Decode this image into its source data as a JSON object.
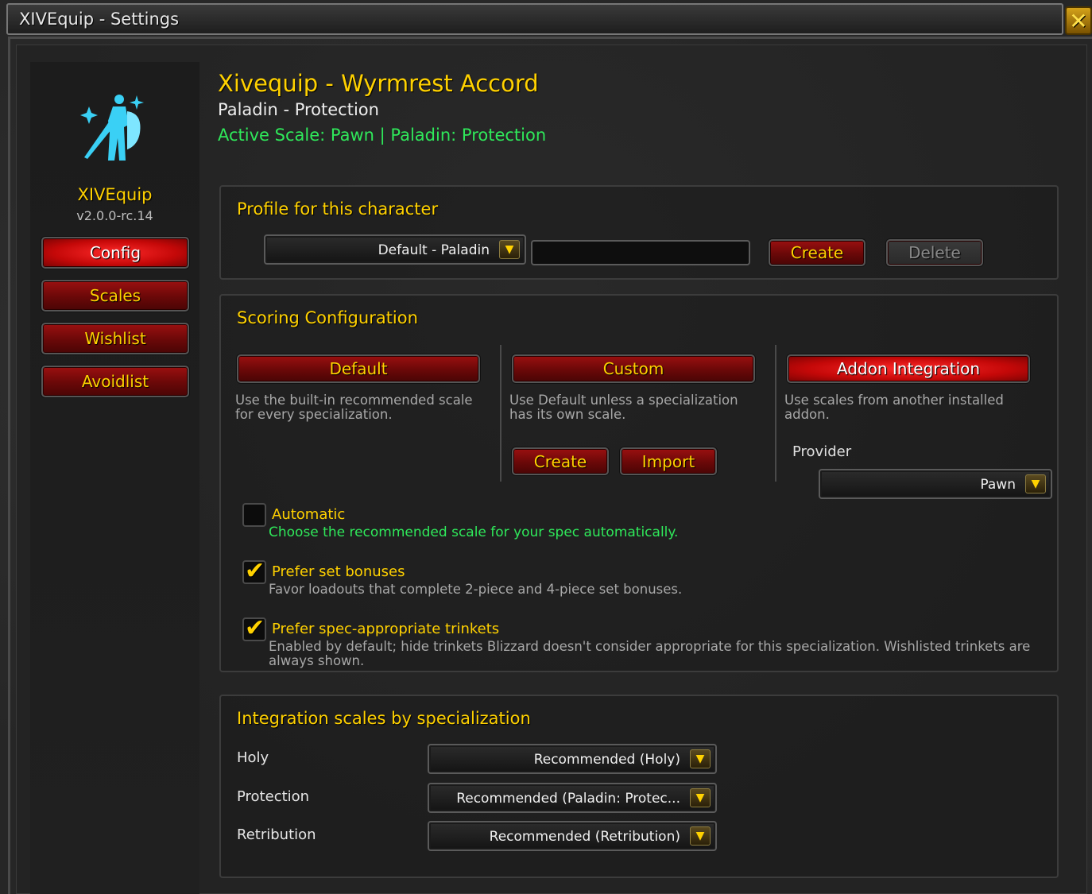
{
  "window": {
    "title": "XIVEquip - Settings",
    "close_label": "✕"
  },
  "sidebar": {
    "app_name": "XIVEquip",
    "version": "v2.0.0-rc.14",
    "nav": [
      {
        "label": "Config",
        "active": true
      },
      {
        "label": "Scales",
        "active": false
      },
      {
        "label": "Wishlist",
        "active": false
      },
      {
        "label": "Avoidlist",
        "active": false
      }
    ]
  },
  "header": {
    "title": "Xivequip - Wyrmrest Accord",
    "subtitle": "Paladin - Protection",
    "active_scale": "Active Scale: Pawn | Paladin: Protection"
  },
  "profile": {
    "section_title": "Profile for this character",
    "selected": "Default - Paladin",
    "name_input_value": "",
    "create_label": "Create",
    "delete_label": "Delete"
  },
  "scoring": {
    "section_title": "Scoring Configuration",
    "modes": [
      {
        "label": "Default",
        "description": "Use the built-in recommended scale for every specialization.",
        "active": false
      },
      {
        "label": "Custom",
        "description": "Use Default unless a specialization has its own scale.",
        "active": false
      },
      {
        "label": "Addon Integration",
        "description": "Use scales from another installed addon.",
        "active": true
      }
    ],
    "custom_create_label": "Create",
    "custom_import_label": "Import",
    "provider_label": "Provider",
    "provider_value": "Pawn",
    "options": [
      {
        "label": "Automatic",
        "description": "Choose the recommended scale for your spec automatically.",
        "checked": false
      },
      {
        "label": "Prefer set bonuses",
        "description": "Favor loadouts that complete 2-piece and 4-piece set bonuses.",
        "checked": true
      },
      {
        "label": "Prefer spec-appropriate trinkets",
        "description": "Enabled by default; hide trinkets Blizzard doesn't consider appropriate for this specialization. Wishlisted trinkets are always shown.",
        "checked": true
      }
    ]
  },
  "integration": {
    "section_title": "Integration scales by specialization",
    "specs": [
      {
        "label": "Holy",
        "value": "Recommended (Holy)"
      },
      {
        "label": "Protection",
        "value": "Recommended (Paladin: Protec..."
      },
      {
        "label": "Retribution",
        "value": "Recommended (Retribution)"
      }
    ]
  },
  "icons": {
    "dropdown_arrow": "▼",
    "check": "✔"
  },
  "colors": {
    "gold": "#ffd100",
    "green": "#2fe85a",
    "red_button": "#9a1010",
    "active_red": "#ff2a2a"
  }
}
